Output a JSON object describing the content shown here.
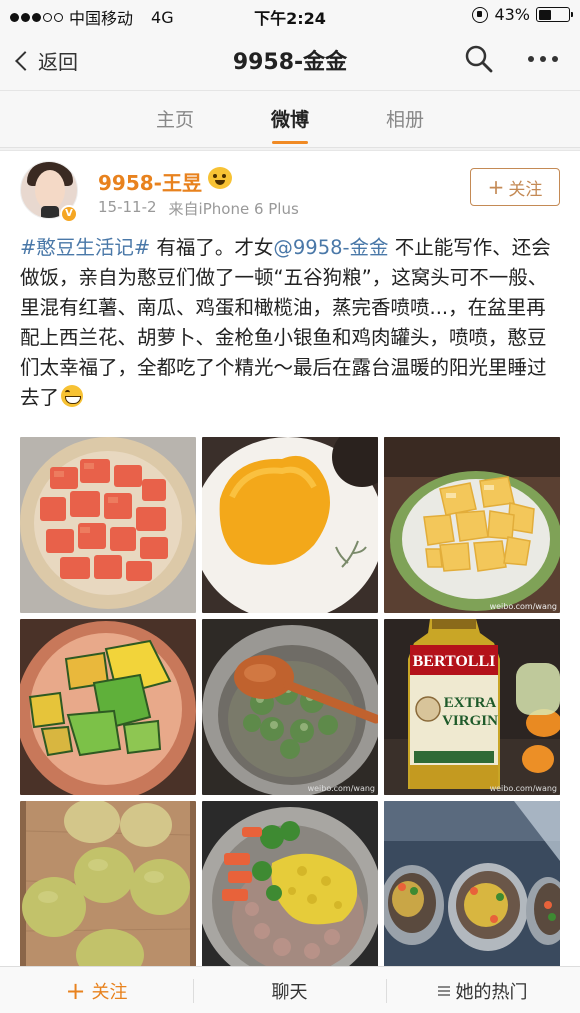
{
  "status_bar": {
    "carrier": "中国移动",
    "network": "4G",
    "time": "下午2:24",
    "battery": "43%",
    "battery_level": 0.43
  },
  "nav": {
    "back_label": "返回",
    "title": "9958-金金",
    "search_icon": "search-icon",
    "more_icon": "more-icon"
  },
  "tabs": [
    {
      "label": "主页",
      "active": false
    },
    {
      "label": "微博",
      "active": true
    },
    {
      "label": "相册",
      "active": false
    }
  ],
  "post": {
    "username": "9958-王昱",
    "date": "15-11-2",
    "source": "来自iPhone 6 Plus",
    "follow_label": "关注",
    "text_hashtag": "#憨豆生活记#",
    "text_part1": " 有福了。才女",
    "text_mention": "@9958-金金",
    "text_part2": " 不止能写作、还会做饭，亲自为憨豆们做了一顿“五谷狗粮”，这窝头可不一般、里混有红薯、南瓜、鸡蛋和橄榄油，蒸完香喷喷...，在盆里再配上西兰花、胡萝卜、金枪鱼小银鱼和鸡肉罐头，喷喷，憨豆们太幸福了，全都吃了个精光～最后在露台温暖的阳光里睡过去了",
    "photos": [
      {
        "name": "photo-sweet-potato",
        "watermark": ""
      },
      {
        "name": "photo-egg-yolk",
        "watermark": ""
      },
      {
        "name": "photo-pumpkin",
        "watermark": "weibo.com/wang"
      },
      {
        "name": "photo-green-squash",
        "watermark": ""
      },
      {
        "name": "photo-broccoli-bowl",
        "watermark": "weibo.com/wang"
      },
      {
        "name": "photo-olive-oil",
        "watermark": "weibo.com/wang",
        "bottle_brand": "BERTOLLI",
        "bottle_line1": "EXTRA",
        "bottle_line2": "VIRGIN"
      },
      {
        "name": "photo-dough-buns",
        "watermark": ""
      },
      {
        "name": "photo-dog-food-bowl",
        "watermark": ""
      },
      {
        "name": "photo-three-bowls",
        "watermark": ""
      }
    ]
  },
  "bottom_bar": {
    "follow": "关注",
    "chat": "聊天",
    "hot": "她的热门"
  }
}
